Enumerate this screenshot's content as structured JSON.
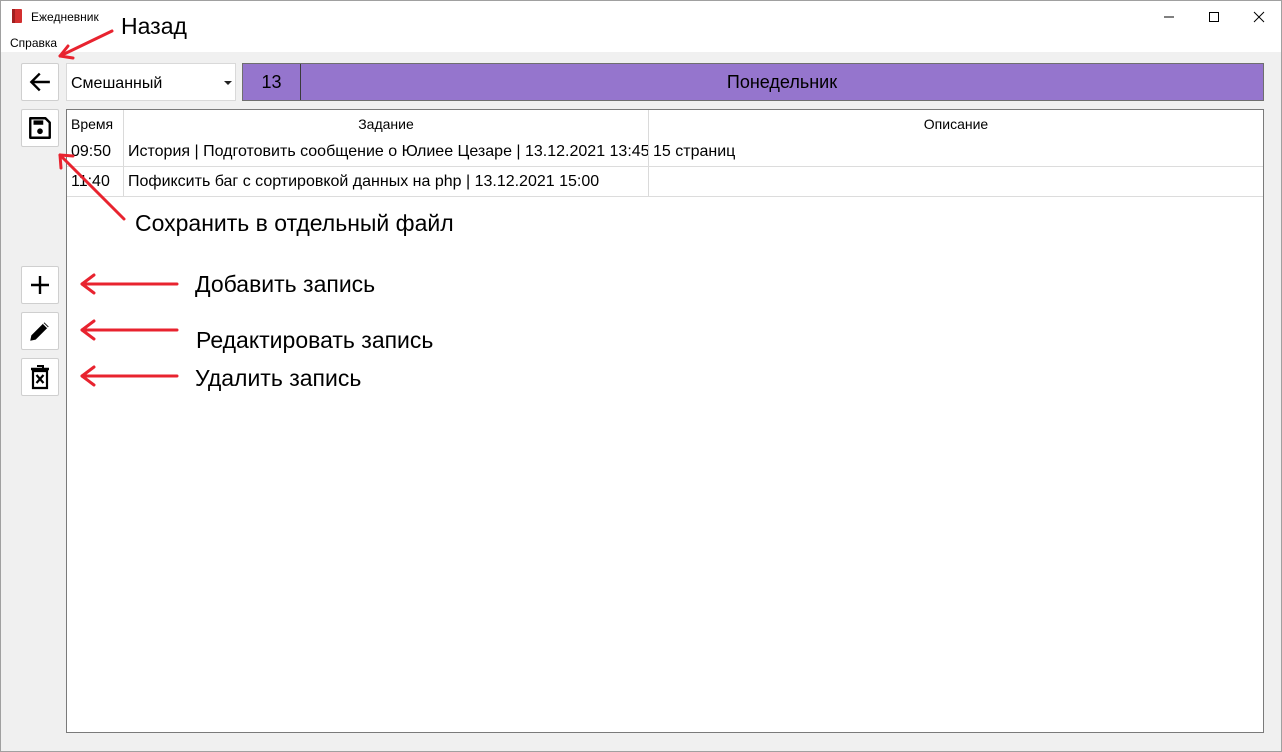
{
  "window": {
    "title": "Ежедневник",
    "icon": "notebook-icon",
    "controls": [
      "minimize-icon",
      "maximize-icon",
      "close-icon"
    ]
  },
  "menu": {
    "items": [
      {
        "label": "Справка"
      }
    ]
  },
  "toolbar": {
    "icons": [
      "arrow-left-icon",
      "floppy-disk-icon",
      "plus-icon",
      "pencil-icon",
      "trash-icon"
    ]
  },
  "mode_select": {
    "value": "Смешанный"
  },
  "day": {
    "number": "13",
    "name": "Понедельник"
  },
  "table": {
    "headers": {
      "time": "Время",
      "task": "Задание",
      "description": "Описание"
    },
    "rows": [
      {
        "time": "09:50",
        "task": "История | Подготовить сообщение о Юлиее Цезаре | 13.12.2021 13:45",
        "description": "15 страниц"
      },
      {
        "time": "11:40",
        "task": "Пофиксить баг с сортировкой данных на php | 13.12.2021 15:00",
        "description": ""
      }
    ]
  },
  "annotations": {
    "back": "Назад",
    "save": "Сохранить в отдельный файл",
    "add": "Добавить запись",
    "edit": "Редактировать запись",
    "delete": "Удалить запись"
  },
  "colors": {
    "accent": "#9575cd",
    "arrow": "#e8232f",
    "app_icon": "#d32f2f"
  }
}
